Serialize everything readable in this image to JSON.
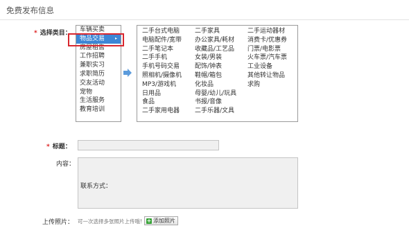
{
  "page": {
    "title": "免费发布信息"
  },
  "form": {
    "category_label": "选择类目：",
    "title_label": "标题：",
    "content_label": "内容：",
    "upload_label": "上传照片：",
    "required_mark": "*",
    "content_text": "联系方式：",
    "title_value": "",
    "upload_hint": "可一次选择多张照片上传哦!",
    "add_photo_label": "添加照片"
  },
  "categories": [
    {
      "label": "车辆买卖"
    },
    {
      "label": "物品交易",
      "selected": true
    },
    {
      "label": "房屋租售"
    },
    {
      "label": "工作招聘"
    },
    {
      "label": "兼职实习"
    },
    {
      "label": "求职简历"
    },
    {
      "label": "交友活动"
    },
    {
      "label": "宠物"
    },
    {
      "label": "生活服务"
    },
    {
      "label": "教育培训"
    }
  ],
  "subcategories": {
    "col1": [
      "二手台式电脑",
      "电脑配件/宽带",
      "二手笔记本",
      "二手手机",
      "手机号码交易",
      "照相机/摄像机",
      "MP3/游戏机",
      "日用品",
      "食品",
      "二手家用电器"
    ],
    "col2": [
      "二手家具",
      "办公家具/耗材",
      "收藏品/工艺品",
      "女装/男装",
      "配饰/钟表",
      "鞋帽/箱包",
      "化妆品",
      "母婴/幼儿/玩具",
      "书报/音像",
      "二手乐器/文具"
    ],
    "col3": [
      "二手运动器材",
      "消费卡/优惠券",
      "门票/电影票",
      "火车票/汽车票",
      "工业设备",
      "其他转让物品",
      "求购"
    ]
  },
  "colors": {
    "selected_bg": "#3c86d6",
    "highlight_border": "#d8262e",
    "required": "#d22"
  },
  "icons": {
    "arrow": "arrow-right-icon",
    "add": "plus-icon"
  }
}
